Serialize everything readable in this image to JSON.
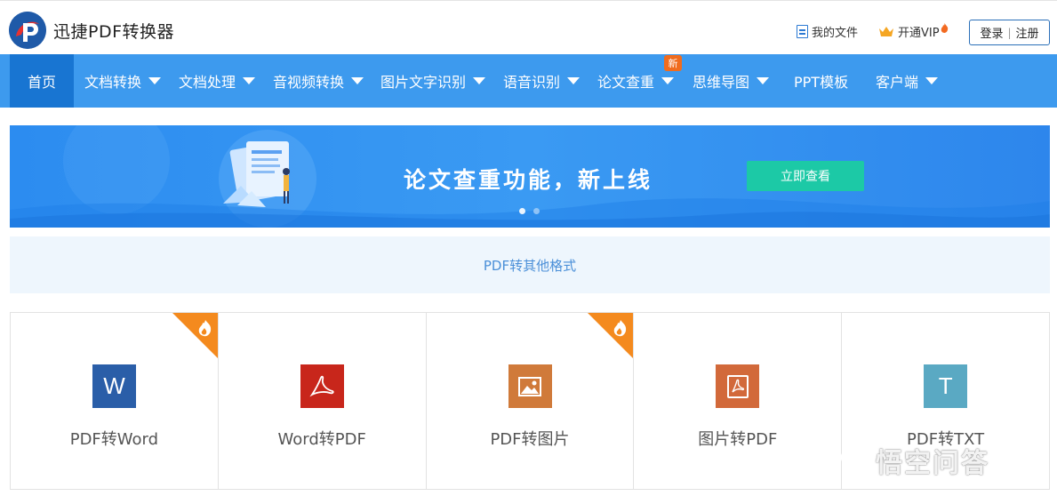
{
  "header": {
    "brand": "迅捷PDF转换器",
    "my_files": "我的文件",
    "vip": "开通VIP",
    "login": "登录",
    "separator": "|",
    "register": "注册"
  },
  "nav": {
    "items": [
      {
        "label": "首页",
        "active": true,
        "has_caret": false
      },
      {
        "label": "文档转换",
        "has_caret": true
      },
      {
        "label": "文档处理",
        "has_caret": true
      },
      {
        "label": "音视频转换",
        "has_caret": true
      },
      {
        "label": "图片文字识别",
        "has_caret": true
      },
      {
        "label": "语音识别",
        "has_caret": true
      },
      {
        "label": "论文查重",
        "has_caret": true,
        "badge": "新"
      },
      {
        "label": "思维导图",
        "has_caret": true
      },
      {
        "label": "PPT模板",
        "has_caret": false
      },
      {
        "label": "客户端",
        "has_caret": true
      }
    ]
  },
  "banner": {
    "title": "论文查重功能，新上线",
    "button": "立即查看",
    "slides": 2,
    "active_slide": 1
  },
  "section": {
    "title": "PDF转其他格式"
  },
  "cards": [
    {
      "label": "PDF转Word",
      "icon": "word-icon",
      "icon_glyph": "W",
      "color": "#2a5ea8",
      "hot": true
    },
    {
      "label": "Word转PDF",
      "icon": "acrobat-icon",
      "color": "#c8261b",
      "hot": false
    },
    {
      "label": "PDF转图片",
      "icon": "image-icon",
      "color": "#d07a3a",
      "hot": true
    },
    {
      "label": "图片转PDF",
      "icon": "pdf-doc-icon",
      "color": "#d2693a",
      "hot": false
    },
    {
      "label": "PDF转TXT",
      "icon": "text-icon",
      "icon_glyph": "T",
      "color": "#5aa9c3",
      "hot": false
    }
  ],
  "watermark": {
    "text": "悟空问答"
  },
  "colors": {
    "nav_bg": "#3d9aee",
    "nav_active": "#1875d2",
    "banner_button": "#1cc9a6",
    "badge_new": "#f06c1e",
    "hot_corner": "#f48a1e"
  }
}
